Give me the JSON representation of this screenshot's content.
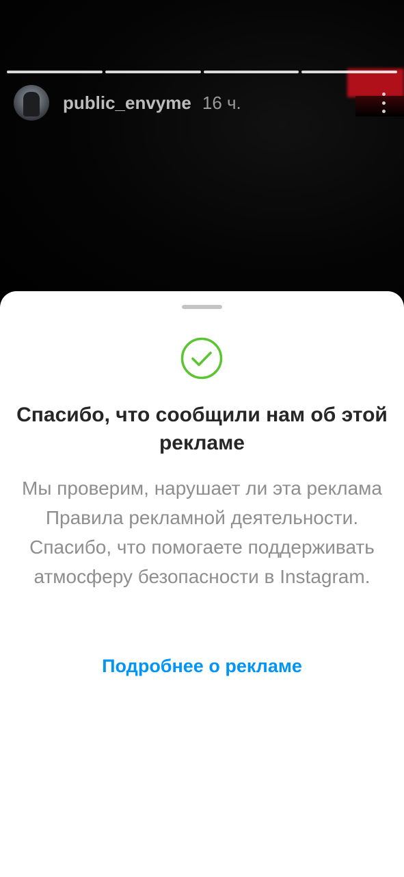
{
  "story": {
    "progress_segments": [
      1,
      1,
      1,
      1
    ],
    "header": {
      "username": "public_envyme",
      "time": "16 ч.",
      "more_icon": "more-vertical-icon"
    }
  },
  "sheet": {
    "icon": "check-circle-icon",
    "icon_color": "#5ac431",
    "title": "Спасибо, что сообщили нам об этой рекламе",
    "description": "Мы проверим, нарушает ли эта реклама Правила рекламной деятельности. Спасибо, что помогаете поддерживать атмосферу безопасности в Instagram.",
    "link_label": "Подробнее о рекламе",
    "link_color": "#0095f6"
  }
}
